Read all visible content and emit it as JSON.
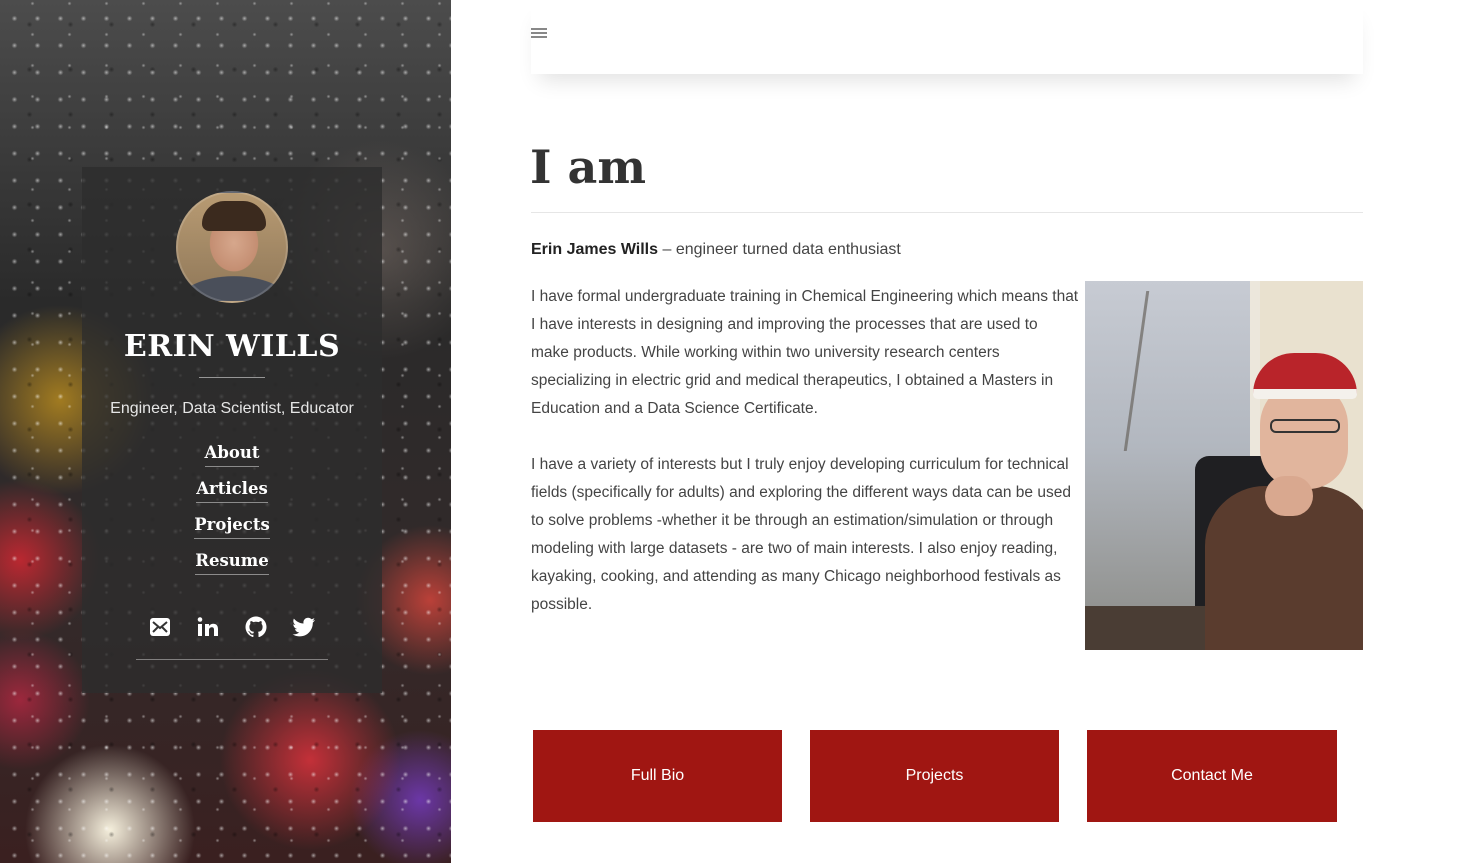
{
  "sidebar": {
    "name": "ERIN WILLS",
    "tagline": "Engineer, Data Scientist, Educator",
    "nav": [
      {
        "label": "About"
      },
      {
        "label": "Articles"
      },
      {
        "label": "Projects"
      },
      {
        "label": "Resume"
      }
    ],
    "social": [
      {
        "icon": "email-icon"
      },
      {
        "icon": "linkedin-icon"
      },
      {
        "icon": "github-icon"
      },
      {
        "icon": "twitter-icon"
      }
    ]
  },
  "header": {
    "menu_icon": "hamburger-menu-icon"
  },
  "main": {
    "title": "I am",
    "intro_name": "Erin James Wills",
    "intro_rest": " – engineer turned data enthusiast",
    "paragraphs": [
      "I have formal undergraduate training in Chemical Engineering which means that I have interests in designing and improving the processes that are used to make products. While working within two university research centers specializing in electric grid and medical therapeutics, I obtained a Masters in Education and a Data Science Certificate.",
      "I have a variety of interests but I truly enjoy developing curriculum for technical fields (specifically for adults) and exploring the different ways data can be used to solve problems -whether it be through an estimation/simulation or through modeling with large datasets - are two of main interests. I also enjoy reading, kayaking, cooking, and attending as many Chicago neighborhood festivals as possible."
    ],
    "buttons": [
      {
        "label": "Full Bio"
      },
      {
        "label": "Projects"
      },
      {
        "label": "Contact Me"
      }
    ]
  },
  "colors": {
    "accent": "#a01612",
    "text": "#444444"
  }
}
